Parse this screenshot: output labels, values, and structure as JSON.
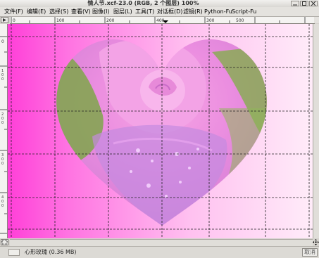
{
  "window": {
    "title": "情人节.xcf-23.0 (RGB, 2 个图层) 100%"
  },
  "menu": {
    "items": [
      "文件(F)",
      "编辑(E)",
      "选择(S)",
      "查看(V)",
      "图像(I)",
      "图层(L)",
      "工具(T)",
      "对话框(D)",
      "滤镜(R)",
      "Python-Fu",
      "Script-Fu"
    ]
  },
  "ruler": {
    "h_labels": [
      "0",
      "100",
      "200",
      "300",
      "400",
      "500"
    ],
    "v_labels": [
      "0",
      "1\n0\n0",
      "2\n0\n0",
      "3\n0\n0",
      "4\n0\n0",
      "5\n0\n0"
    ]
  },
  "status": {
    "layer_info": "心形玫瑰 (0.36 MB)",
    "cancel_label": "取消"
  },
  "colors": {
    "magenta": "#ff3fd8",
    "pink_light": "#ffe0f6",
    "rose": "#e886d8",
    "leaf": "#7fa64a"
  },
  "icons": [
    "close-icon",
    "maximize-icon",
    "minimize-icon",
    "menu-arrow-icon",
    "navigate-icon",
    "quick-mask-icon"
  ]
}
